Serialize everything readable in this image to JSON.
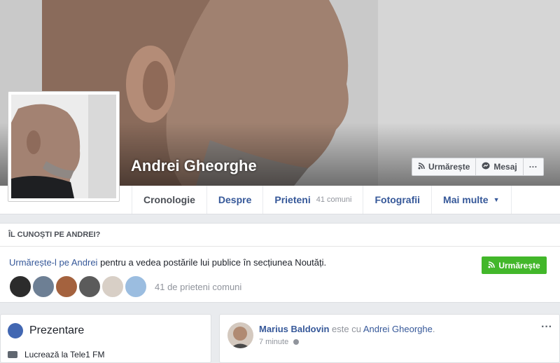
{
  "profile": {
    "name": "Andrei Gheorghe"
  },
  "cover_actions": [
    {
      "icon": "rss-icon",
      "label": "Urmărește"
    },
    {
      "icon": "messenger-icon",
      "label": "Mesaj"
    },
    {
      "icon": "more-icon",
      "label": "···"
    }
  ],
  "tabs": [
    {
      "label": "Cronologie",
      "active": true
    },
    {
      "label": "Despre"
    },
    {
      "label": "Prieteni",
      "count": "41 comuni"
    },
    {
      "label": "Fotografii"
    },
    {
      "label": "Mai multe",
      "caret": "▼"
    }
  ],
  "know_card": {
    "header": "ÎL CUNOȘTI PE ANDREI?",
    "link_text": "Urmărește-l pe Andrei",
    "rest_text": " pentru a vedea postările lui publice în secțiunea Noutăți.",
    "follow_label": "Urmărește",
    "follow_icon": "rss-icon",
    "mutual_friends": "41 de prieteni comuni",
    "accent_color": "#42b72a"
  },
  "intro": {
    "title": "Prezentare",
    "icon": "globe-icon",
    "line": "Lucrează la Tele1 FM"
  },
  "post": {
    "author": "Marius Baldovin",
    "connector": " este cu ",
    "tagged": "Andrei Gheorghe",
    "suffix": ".",
    "time": "7 minute",
    "menu": "···"
  },
  "colors": {
    "link": "#365899",
    "background": "#e9ebee"
  }
}
